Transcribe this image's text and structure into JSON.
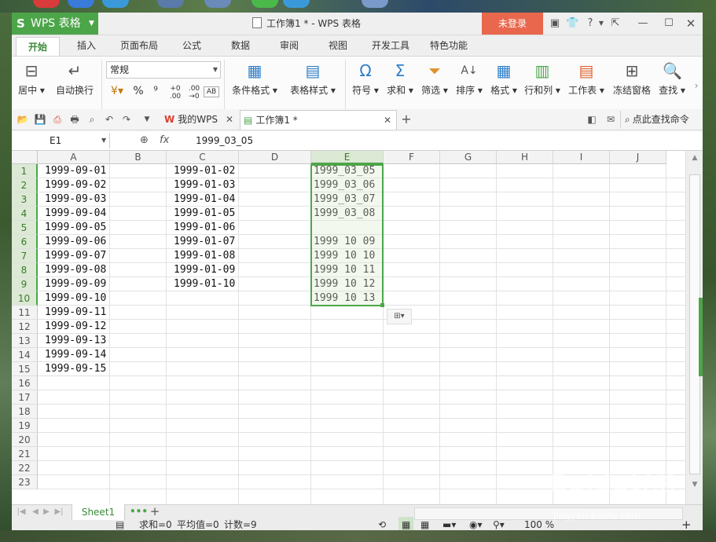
{
  "app": {
    "button_label": "WPS 表格",
    "title": "工作簿1 * - WPS 表格",
    "login_label": "未登录"
  },
  "ribbon_tabs": [
    "开始",
    "插入",
    "页面布局",
    "公式",
    "数据",
    "审阅",
    "视图",
    "开发工具",
    "特色功能"
  ],
  "ribbon": {
    "merge_label": "居中",
    "wrap_label": "自动换行",
    "number_format": "常规",
    "percent": "%",
    "comma": "⁹",
    "cond_format": "条件格式",
    "table_style": "表格样式",
    "symbol": "符号",
    "sum": "求和",
    "filter": "筛选",
    "sort": "排序",
    "format": "格式",
    "rowcol": "行和列",
    "worksheet": "工作表",
    "freeze": "冻结窗格",
    "find": "查找"
  },
  "quickbar": {
    "tab_mywps": "我的WPS",
    "tab_book": "工作簿1 *",
    "search_label": "点此查找命令"
  },
  "formula": {
    "name_box": "E1",
    "fx": "fx",
    "content": "1999_03_05"
  },
  "columns": [
    "A",
    "B",
    "C",
    "D",
    "E",
    "F",
    "G",
    "H",
    "I",
    "J"
  ],
  "rows": [
    "1",
    "2",
    "3",
    "4",
    "5",
    "6",
    "7",
    "8",
    "9",
    "10",
    "11",
    "12",
    "13",
    "14",
    "15",
    "16",
    "17",
    "18",
    "19",
    "20",
    "21",
    "22",
    "23"
  ],
  "cells": {
    "A": [
      "1999-09-01",
      "1999-09-02",
      "1999-09-03",
      "1999-09-04",
      "1999-09-05",
      "1999-09-06",
      "1999-09-07",
      "1999-09-08",
      "1999-09-09",
      "1999-09-10",
      "1999-09-11",
      "1999-09-12",
      "1999-09-13",
      "1999-09-14",
      "1999-09-15"
    ],
    "C": [
      "1999-01-02",
      "1999-01-03",
      "1999-01-04",
      "1999-01-05",
      "1999-01-06",
      "1999-01-07",
      "1999-01-08",
      "1999-01-09",
      "1999-01-10"
    ],
    "E": [
      "1999_03_05",
      "1999_03_06",
      "1999_03_07",
      "1999_03_08",
      "",
      "1999 10 09",
      "1999 10 10",
      "1999 10 11",
      "1999 10 12",
      "1999 10 13"
    ]
  },
  "sheet": {
    "name": "Sheet1"
  },
  "status": {
    "sum": "求和=0",
    "avg": "平均值=0",
    "count": "计数=9",
    "zoom": "100 %"
  },
  "watermark": {
    "logo": "Baidu经验",
    "url": "jingyan.baidu.com"
  },
  "colors": {
    "accent": "#4da54a",
    "login": "#e8674d"
  }
}
